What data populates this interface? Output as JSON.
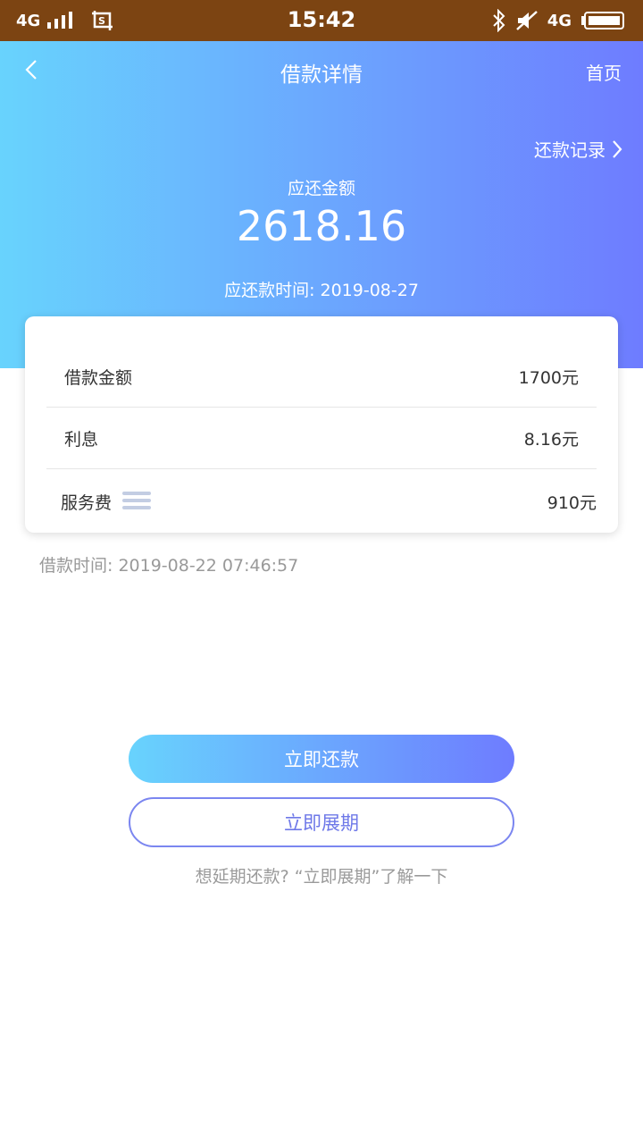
{
  "status_bar": {
    "network_left": "4G",
    "time": "15:42",
    "network_right": "4G"
  },
  "header": {
    "title": "借款详情",
    "home_label": "首页",
    "record_label": "还款记录"
  },
  "summary": {
    "due_label": "应还金额",
    "due_amount": "2618.16",
    "due_date_label": "应还款时间: 2019-08-27"
  },
  "details": {
    "rows": [
      {
        "label": "借款金额",
        "value": "1700元"
      },
      {
        "label": "利息",
        "value": "8.16元"
      },
      {
        "label": "服务费",
        "value": "910元"
      }
    ]
  },
  "loan_time": "借款时间: 2019-08-22 07:46:57",
  "actions": {
    "repay_label": "立即还款",
    "extend_label": "立即展期",
    "hint": "想延期还款? “立即展期”了解一下"
  },
  "colors": {
    "status_bar_bg": "#7c4412",
    "gradient_start": "#68d3fd",
    "gradient_end": "#6e7cff",
    "outline_accent": "#7b86f0"
  }
}
